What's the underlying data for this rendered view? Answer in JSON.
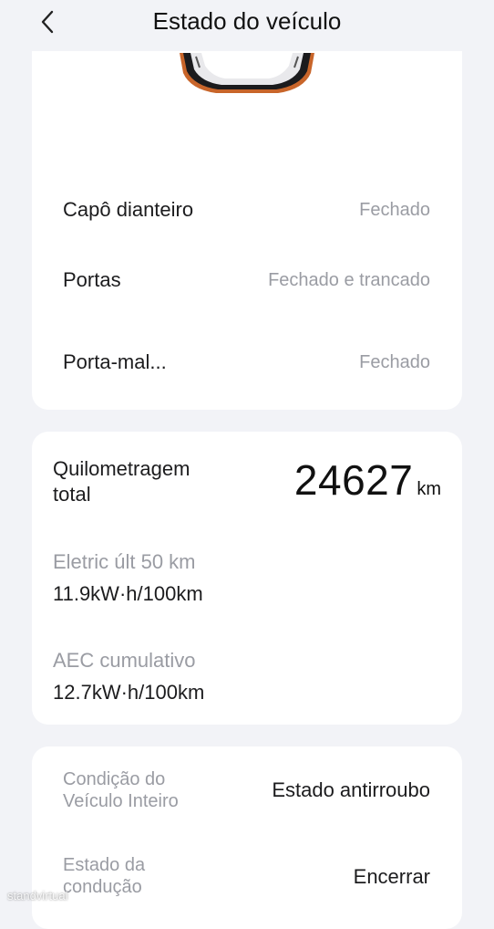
{
  "header": {
    "title": "Estado do veículo",
    "back_icon": "chevron-left-icon"
  },
  "doors": {
    "rows": [
      {
        "label": "Capô dianteiro",
        "value": "Fechado"
      },
      {
        "label": "Portas",
        "value": "Fechado e trancado"
      },
      {
        "label": "Porta-mal...",
        "value": "Fechado"
      }
    ]
  },
  "mileage": {
    "label": "Quilometragem total",
    "value": "24627",
    "unit": "km",
    "recent_label": "Eletric últ 50 km",
    "recent_value": "11.9kW·h/100km",
    "cumulative_label": "AEC cumulativo",
    "cumulative_value": "12.7kW·h/100km"
  },
  "condition": {
    "vehicle_label": "Condição do Veículo Inteiro",
    "vehicle_value": "Estado antirroubo",
    "driving_label": "Estado da condução",
    "driving_value": "Encerrar"
  },
  "watermark": "standvirtual"
}
